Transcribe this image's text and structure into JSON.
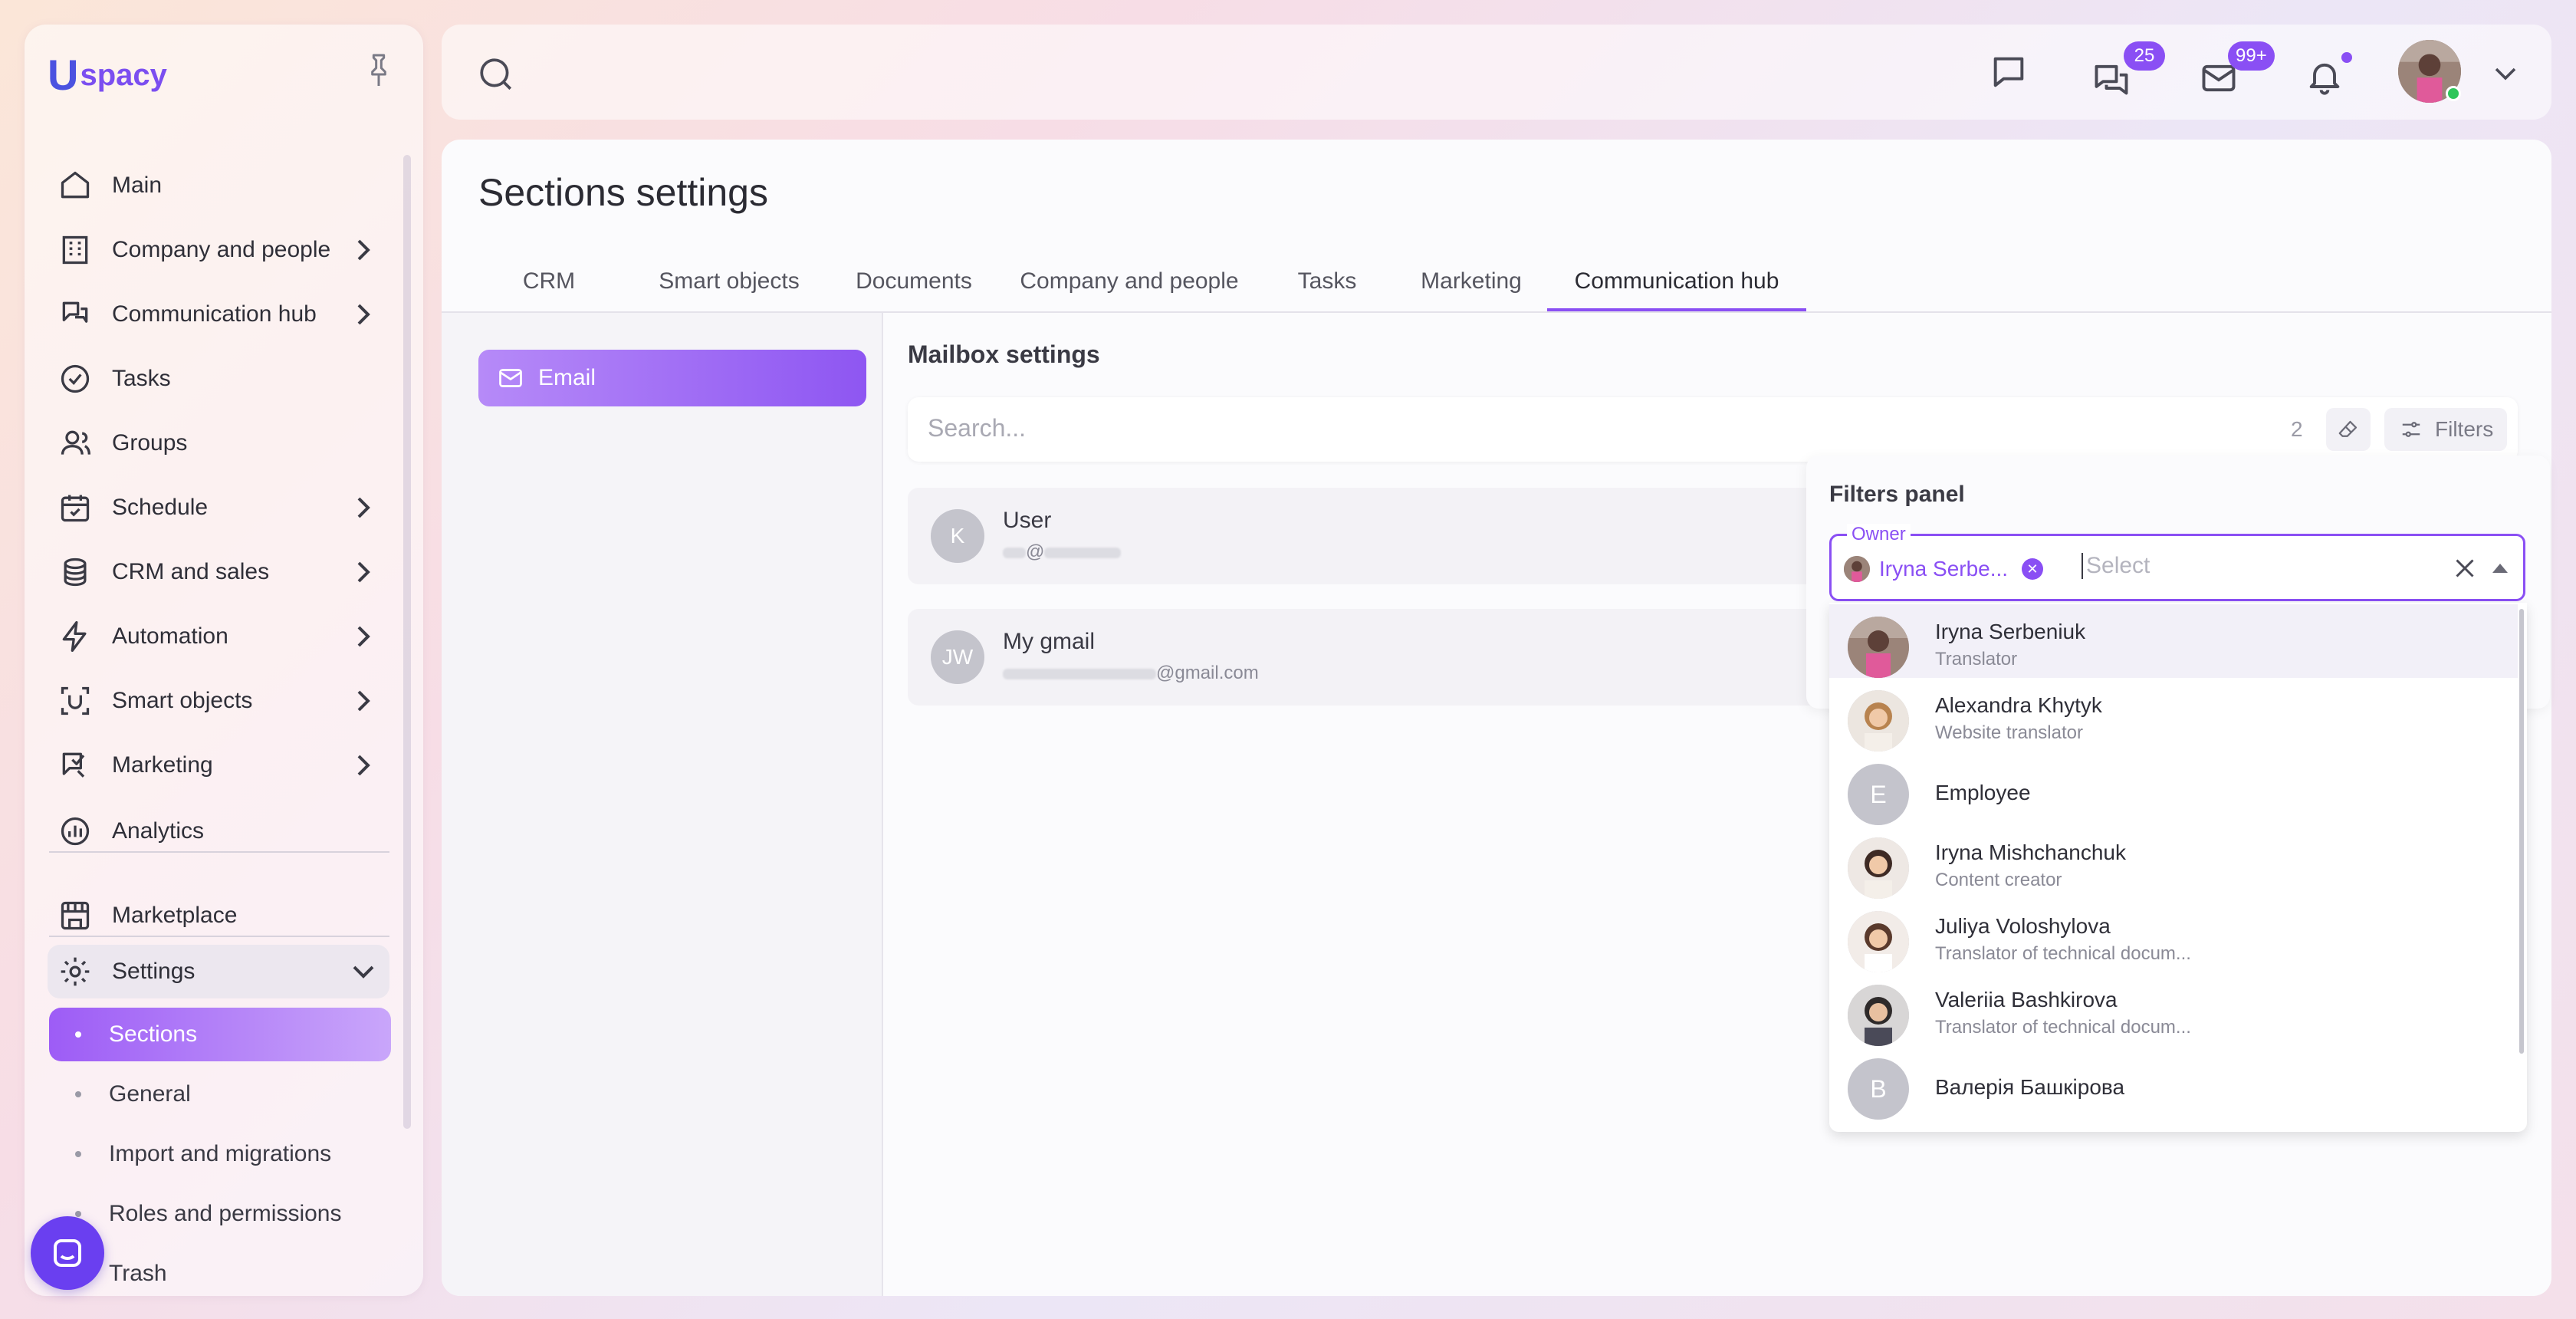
{
  "sidebar": {
    "logo": {
      "mark": "U",
      "text": "spacy"
    },
    "items": [
      {
        "label": "Main",
        "icon": "home-icon"
      },
      {
        "label": "Company and people",
        "icon": "building-icon"
      },
      {
        "label": "Communication hub",
        "icon": "communication-icon"
      },
      {
        "label": "Tasks",
        "icon": "check-circle-icon"
      },
      {
        "label": "Groups",
        "icon": "people-icon"
      },
      {
        "label": "Schedule",
        "icon": "calendar-icon"
      },
      {
        "label": "CRM and sales",
        "icon": "coins-icon"
      },
      {
        "label": "Automation",
        "icon": "lightning-icon"
      },
      {
        "label": "Smart objects",
        "icon": "smart-object-icon"
      },
      {
        "label": "Marketing",
        "icon": "megaphone-icon"
      },
      {
        "label": "Analytics",
        "icon": "analytics-icon"
      },
      {
        "label": "Marketplace",
        "icon": "store-icon"
      },
      {
        "label": "Settings",
        "icon": "gear-icon"
      }
    ],
    "settings_sub": [
      {
        "label": "Sections",
        "active": true
      },
      {
        "label": "General"
      },
      {
        "label": "Import and migrations"
      },
      {
        "label": "Roles and permissions"
      },
      {
        "label": "Trash"
      }
    ]
  },
  "topbar": {
    "chat_badge": "25",
    "mail_badge": "99+"
  },
  "page": {
    "title": "Sections settings",
    "tabs": [
      "CRM",
      "Smart objects",
      "Documents",
      "Company and people",
      "Tasks",
      "Marketing",
      "Communication hub"
    ],
    "active_tab": "Communication hub",
    "left_menu": {
      "email_label": "Email"
    },
    "mailbox_title": "Mailbox settings",
    "search": {
      "placeholder": "Search...",
      "count": "2",
      "filters_label": "Filters"
    },
    "mailboxes": [
      {
        "initials": "K",
        "name": "User",
        "sub": "@"
      },
      {
        "initials": "JW",
        "name": "My gmail",
        "sub_tail": "@gmail.com"
      }
    ]
  },
  "filters_panel": {
    "title": "Filters panel",
    "owner_label": "Owner",
    "selected_chip": "Iryna Serbe...",
    "placeholder": "Select",
    "options": [
      {
        "name": "Iryna Serbeniuk",
        "role": "Translator"
      },
      {
        "name": "Alexandra Khytyk",
        "role": "Website translator"
      },
      {
        "name": "Employee",
        "initial": "E"
      },
      {
        "name": "Iryna Mishchanchuk",
        "role": "Content creator"
      },
      {
        "name": "Juliya Voloshylova",
        "role": "Translator of technical docum..."
      },
      {
        "name": "Valeriia Bashkirova",
        "role": "Translator of technical docum..."
      },
      {
        "name": "Валерія Башкірова",
        "initial": "В"
      }
    ]
  },
  "colors": {
    "accent": "#8a4ff4",
    "brand_blue": "#4b52e0",
    "online": "#2ec65a"
  }
}
